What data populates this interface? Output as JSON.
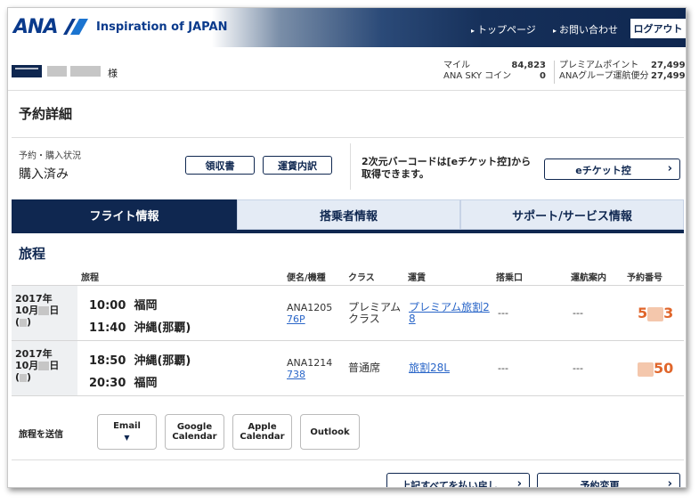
{
  "header": {
    "logo": "ANA",
    "tagline": "Inspiration of JAPAN",
    "links": [
      "トップページ",
      "お問い合わせ"
    ],
    "logout_label": "ログアウト"
  },
  "user": {
    "suffix": "様",
    "miles_label": "マイル",
    "miles_value": "84,823",
    "sky_coin_label": "ANA SKY コイン",
    "sky_coin_value": "0",
    "premium_points_label": "プレミアムポイント",
    "premium_points_value": "27,499",
    "group_label": "ANAグループ運航便分",
    "group_value": "27,499"
  },
  "page": {
    "title": "予約詳細"
  },
  "status": {
    "label": "予約・購入状況",
    "value": "購入済み",
    "receipt_label": "領収書",
    "fare_detail_label": "運賃内訳",
    "barcode_note": "2次元バーコードは[eチケット控]から取得できます。",
    "eticket_label": "eチケット控"
  },
  "tabs": [
    {
      "label": "フライト情報",
      "active": true
    },
    {
      "label": "搭乗者情報",
      "active": false
    },
    {
      "label": "サポート/サービス情報",
      "active": false
    }
  ],
  "itinerary": {
    "title": "旅程",
    "columns": [
      "旅程",
      "便名/機種",
      "クラス",
      "運賃",
      "搭乗口",
      "運航案内",
      "予約番号"
    ],
    "rows": [
      {
        "date_year": "2017年",
        "date_month": "10月",
        "date_day": "日",
        "dep_time": "10:00",
        "dep_airport": "福岡",
        "arr_time": "11:40",
        "arr_airport": "沖縄(那覇)",
        "flight": "ANA1205",
        "aircraft": "76P",
        "class_line1": "プレミアム",
        "class_line2": "クラス",
        "fare_line1": "プレミアム旅割2",
        "fare_line2": "8",
        "gate": "---",
        "info": "---",
        "resnum_visible_a": "5",
        "resnum_visible_b": "3"
      },
      {
        "date_year": "2017年",
        "date_month": "10月",
        "date_day": "日",
        "dep_time": "18:50",
        "dep_airport": "沖縄(那覇)",
        "arr_time": "20:30",
        "arr_airport": "福岡",
        "flight": "ANA1214",
        "aircraft": "738",
        "class_line1": "普通席",
        "class_line2": "",
        "fare_line1": "旅割28L",
        "fare_line2": "",
        "gate": "---",
        "info": "---",
        "resnum_visible_a": "",
        "resnum_visible_b": "50"
      }
    ]
  },
  "send": {
    "label": "旅程を送信",
    "email": "Email",
    "google_line1": "Google",
    "google_line2": "Calendar",
    "apple_line1": "Apple",
    "apple_line2": "Calendar",
    "outlook": "Outlook"
  },
  "actions": {
    "refund_label": "上記すべてを払い戻し",
    "change_label": "予約変更"
  },
  "colors": {
    "navy": "#0f2750",
    "link": "#2a66c8",
    "accent": "#e0662b"
  }
}
